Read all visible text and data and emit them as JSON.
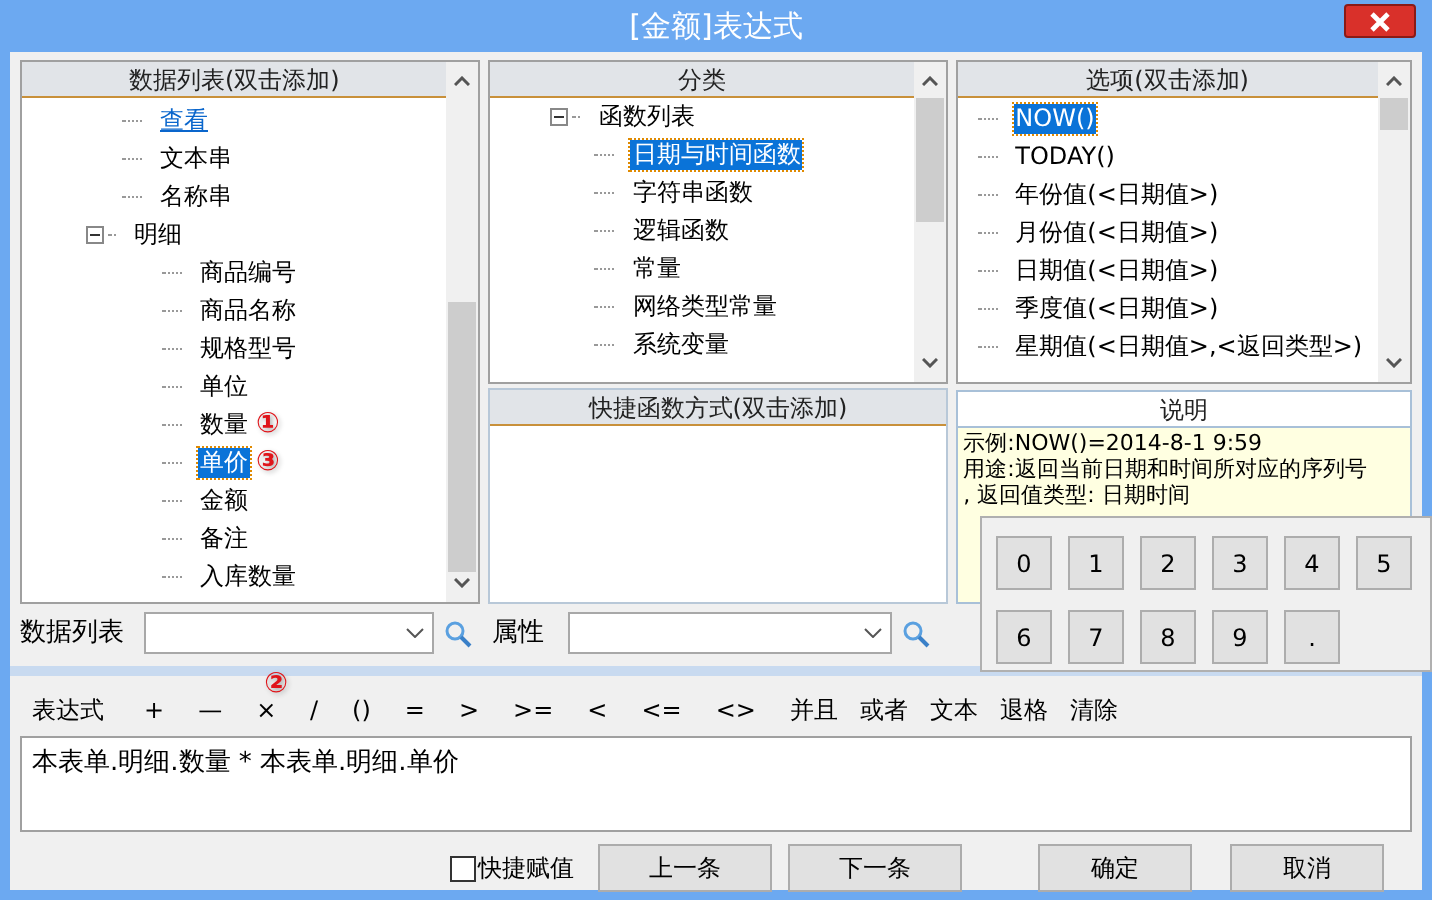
{
  "window": {
    "title": "[金额]表达式"
  },
  "data_list": {
    "header": "数据列表(双击添加)",
    "items": [
      {
        "label": "查看",
        "kind": "link",
        "selected": false
      },
      {
        "label": "文本串",
        "kind": "field",
        "selected": false
      },
      {
        "label": "名称串",
        "kind": "field",
        "selected": false
      },
      {
        "label": "明细",
        "kind": "field",
        "selected": false,
        "expanded": true,
        "children": [
          {
            "label": "商品编号",
            "selected": false
          },
          {
            "label": "商品名称",
            "selected": false
          },
          {
            "label": "规格型号",
            "selected": false
          },
          {
            "label": "单位",
            "selected": false
          },
          {
            "label": "数量",
            "selected": false,
            "marker": "①"
          },
          {
            "label": "单价",
            "selected": true,
            "marker": "③"
          },
          {
            "label": "金额",
            "selected": false
          },
          {
            "label": "备注",
            "selected": false
          },
          {
            "label": "入库数量",
            "selected": false
          }
        ]
      }
    ]
  },
  "category": {
    "header": "分类",
    "items": [
      {
        "label": "函数列表",
        "selected": false,
        "expanded": true,
        "children": [
          {
            "label": "日期与时间函数",
            "selected": true
          },
          {
            "label": "字符串函数",
            "selected": false
          },
          {
            "label": "逻辑函数",
            "selected": false
          },
          {
            "label": "常量",
            "selected": false
          },
          {
            "label": "网络类型常量",
            "selected": false
          },
          {
            "label": "系统变量",
            "selected": false
          }
        ]
      }
    ]
  },
  "quick_functions": {
    "header": "快捷函数方式(双击添加)"
  },
  "options": {
    "header": "选项(双击添加)",
    "items": [
      {
        "label": "NOW()",
        "selected": true
      },
      {
        "label": "TODAY()",
        "selected": false
      },
      {
        "label": "年份值(<日期值>)",
        "selected": false
      },
      {
        "label": "月份值(<日期值>)",
        "selected": false
      },
      {
        "label": "日期值(<日期值>)",
        "selected": false
      },
      {
        "label": "季度值(<日期值>)",
        "selected": false
      },
      {
        "label": "星期值(<日期值>,<返回类型>)",
        "selected": false
      }
    ]
  },
  "description": {
    "header": "说明",
    "lines": [
      "示例:NOW()=2014-8-1 9:59",
      "用途:返回当前日期和时间所对应的序列号",
      ", 返回值类型: 日期时间"
    ]
  },
  "keypad": [
    "0",
    "1",
    "2",
    "3",
    "4",
    "5",
    "6",
    "7",
    "8",
    "9",
    "."
  ],
  "filters": [
    {
      "label": "数据列表"
    },
    {
      "label": "属性"
    }
  ],
  "toolbar": {
    "label": "表达式",
    "operators": [
      {
        "text": "+"
      },
      {
        "text": "—"
      },
      {
        "text": "×",
        "marker": "②"
      },
      {
        "text": "/"
      },
      {
        "text": "()"
      },
      {
        "text": "="
      },
      {
        "text": ">"
      },
      {
        "text": ">="
      },
      {
        "text": "<"
      },
      {
        "text": "<="
      },
      {
        "text": "<>"
      },
      {
        "text": "并且"
      },
      {
        "text": "或者"
      },
      {
        "text": "文本"
      },
      {
        "text": "退格"
      },
      {
        "text": "清除"
      }
    ]
  },
  "expression": "本表单.明细.数量 * 本表单.明细.单价",
  "quick_assign": {
    "label": "快捷赋值",
    "checked": false
  },
  "buttons": [
    "上一条",
    "下一条",
    "确定",
    "取消"
  ]
}
